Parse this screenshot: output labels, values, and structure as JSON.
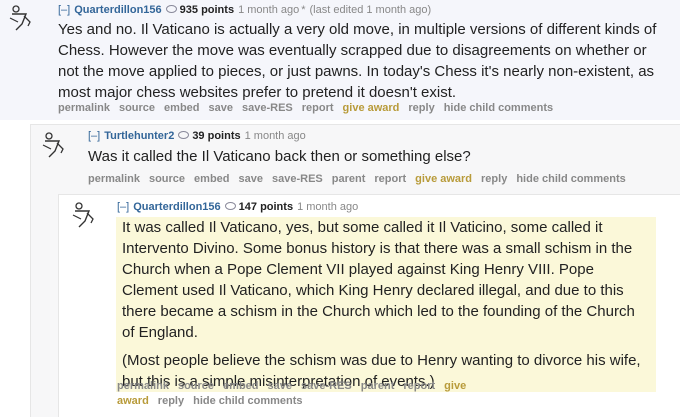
{
  "comments": [
    {
      "toggle": "[–]",
      "author": "Quarterdillon156",
      "score": "935 points",
      "time": "1 month ago",
      "star": "*",
      "edited": "(last edited 1 month ago)",
      "paragraphs": [
        "Yes and no. Il Vaticano is actually a very old move, in multiple versions of different kinds of Chess. However the move was eventually scrapped due to disagreements on whether or not the move applied to pieces, or just pawns. In today's Chess it's nearly non-existent, as most major chess websites prefer to pretend it doesn't exist."
      ],
      "buttons": [
        "permalink",
        "source",
        "embed",
        "save",
        "save-RES",
        "report",
        "give award",
        "reply",
        "hide child comments"
      ]
    },
    {
      "toggle": "[–]",
      "author": "Turtlehunter2",
      "score": "39 points",
      "time": "1 month ago",
      "paragraphs": [
        "Was it called the Il Vaticano back then or something else?"
      ],
      "buttons": [
        "permalink",
        "source",
        "embed",
        "save",
        "save-RES",
        "parent",
        "report",
        "give award",
        "reply",
        "hide child comments"
      ]
    },
    {
      "toggle": "[–]",
      "author": "Quarterdillon156",
      "score": "147 points",
      "time": "1 month ago",
      "paragraphs": [
        "It was called Il Vaticano, yes, but some called it Il Vaticino, some called it Intervento Divino. Some bonus history is that there was a small schism in the Church when a Pope Clement VII played against King Henry VIII. Pope Clement used Il Vaticano, which King Henry declared illegal, and due to this there became a schism in the Church which led to the founding of the Church of England.",
        "(Most people believe the schism was due to Henry wanting to divorce his wife, but this is a simple misinterpretation of events.)"
      ],
      "buttons": [
        "permalink",
        "source",
        "embed",
        "save",
        "save-RES",
        "parent",
        "report",
        "give award",
        "reply",
        "hide child comments"
      ]
    }
  ]
}
